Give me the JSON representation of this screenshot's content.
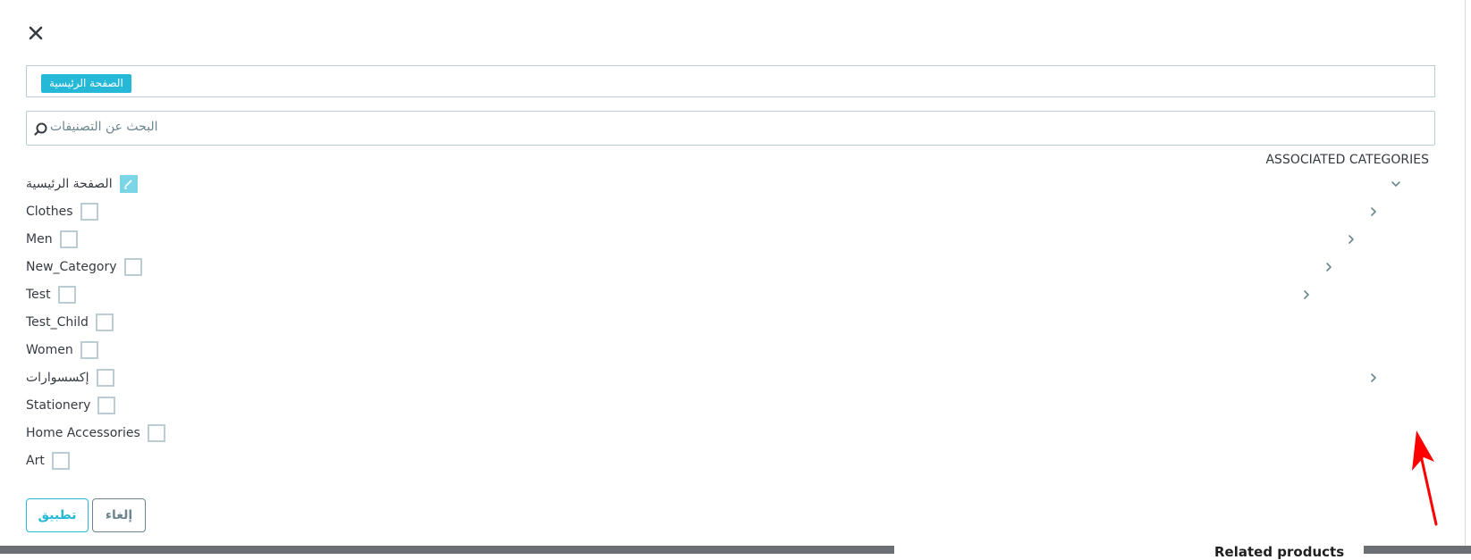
{
  "modal": {
    "selected_tag": "الصفحة الرئيسية",
    "search": {
      "placeholder": "البحث عن التصنيفات"
    },
    "associated_label": "ASSOCIATED CATEGORIES"
  },
  "tree": {
    "root": {
      "label": "الصفحة الرئيسية",
      "checked": true,
      "expanded": true
    },
    "items": [
      {
        "label": "Clothes",
        "checked": false,
        "has_children": true
      },
      {
        "label": "Men",
        "checked": false,
        "has_children": true
      },
      {
        "label": "New_Category",
        "checked": false,
        "has_children": true
      },
      {
        "label": "Test",
        "checked": false,
        "has_children": true
      },
      {
        "label": "Test_Child",
        "checked": false,
        "has_children": false
      },
      {
        "label": "Women",
        "checked": false,
        "has_children": false
      },
      {
        "label": "إكسسوارات",
        "checked": false,
        "has_children": true
      },
      {
        "label": "Stationery",
        "checked": false,
        "has_children": false
      },
      {
        "label": "Home Accessories",
        "checked": false,
        "has_children": false
      },
      {
        "label": "Art",
        "checked": false,
        "has_children": false
      }
    ]
  },
  "footer": {
    "apply_label": "تطبيق",
    "cancel_label": "إلغاء"
  },
  "background": {
    "partial_heading": "Related products"
  },
  "colors": {
    "accent": "#25b9d7",
    "border": "#bbcdd2",
    "annotation": "#ff0000"
  }
}
